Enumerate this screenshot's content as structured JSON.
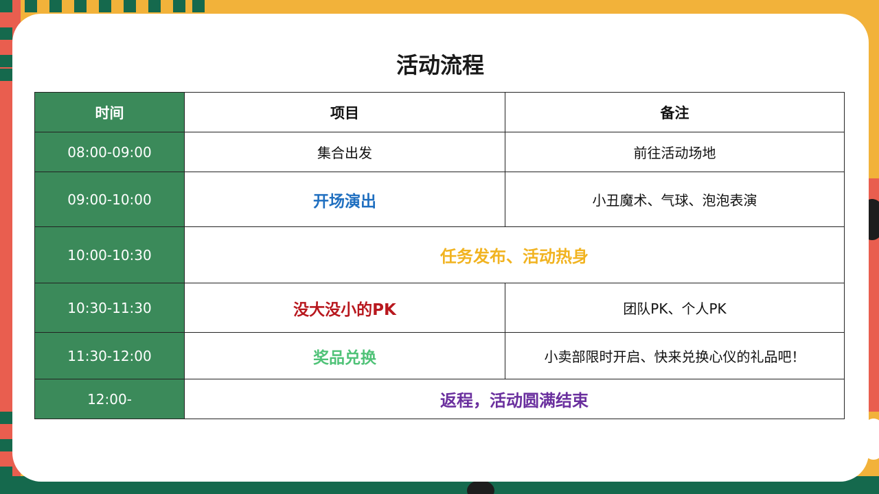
{
  "title": "活动流程",
  "table": {
    "headers": [
      "时间",
      "项目",
      "备注"
    ],
    "rows": [
      {
        "time": "08:00-09:00",
        "item": "集合出发",
        "note": "前往活动场地"
      },
      {
        "time": "09:00-10:00",
        "item": "开场演出",
        "note": "小丑魔术、气球、泡泡表演"
      },
      {
        "time": "10:00-10:30",
        "item": "任务发布、活动热身",
        "note": ""
      },
      {
        "time": "10:30-11:30",
        "item": "没大没小的PK",
        "note": "团队PK、个人PK"
      },
      {
        "time": "11:30-12:00",
        "item": "奖品兑换",
        "note": "小卖部限时开启、快来兑换心仪的礼品吧！"
      },
      {
        "time": "12:00-",
        "item": "返程，活动圆满结束",
        "note": ""
      }
    ]
  },
  "colors": {
    "time_column_bg": "#3b8a5a",
    "opening_show": "#1f6fc0",
    "warmup": "#f1b320",
    "pk": "#b8181e",
    "prize": "#4fc277",
    "return": "#6a2f9e"
  }
}
